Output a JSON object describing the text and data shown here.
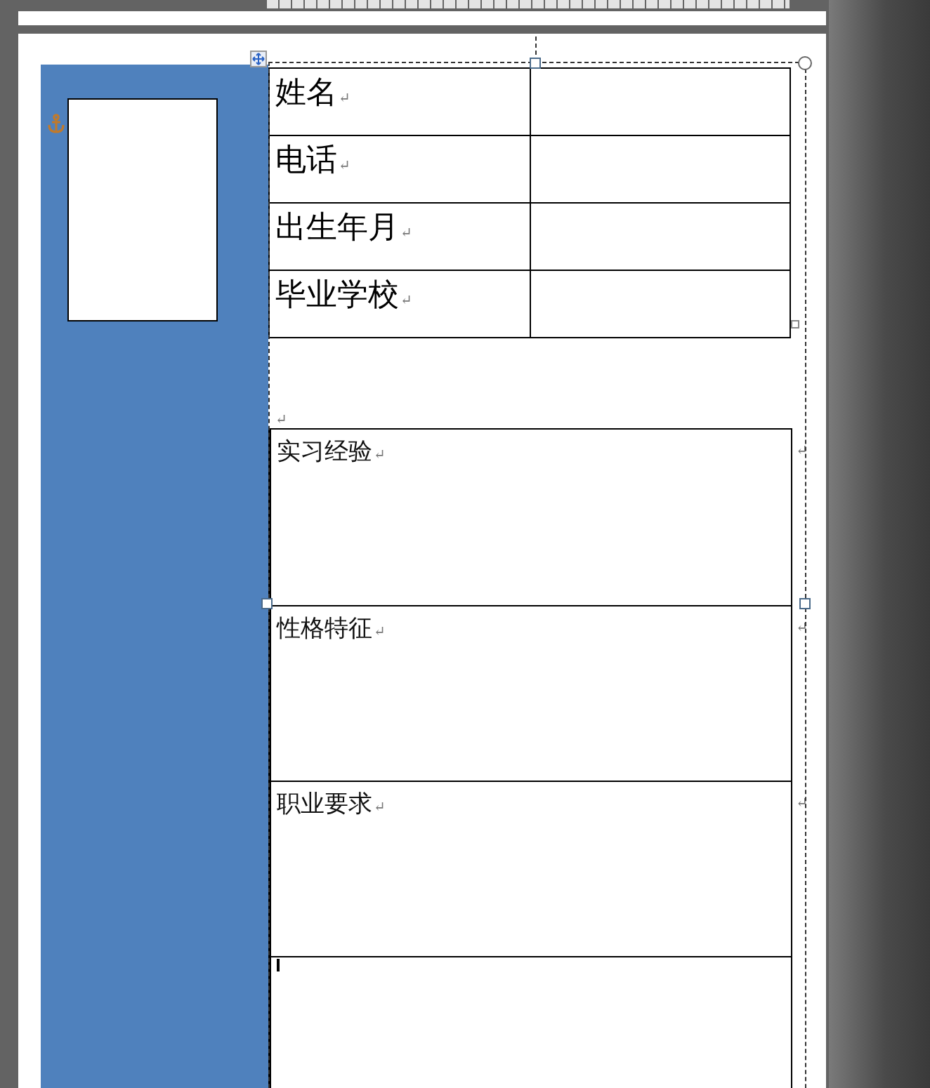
{
  "info_table": {
    "rows": [
      {
        "label": "姓名",
        "mark": "↵"
      },
      {
        "label": "电话",
        "mark": "↵"
      },
      {
        "label": "出生年月",
        "mark": "↵"
      },
      {
        "label": "毕业学校",
        "mark": "↵"
      }
    ]
  },
  "blank_paragraph": {
    "mark": "↵"
  },
  "section_table": {
    "rows": [
      {
        "label": "实习经验",
        "mark": "↵",
        "end_mark": "↵",
        "caret": false
      },
      {
        "label": "性格特征",
        "mark": "↵",
        "end_mark": "↵",
        "caret": false
      },
      {
        "label": "职业要求",
        "mark": "↵",
        "end_mark": "↵",
        "caret": false
      },
      {
        "caret": true
      }
    ]
  }
}
